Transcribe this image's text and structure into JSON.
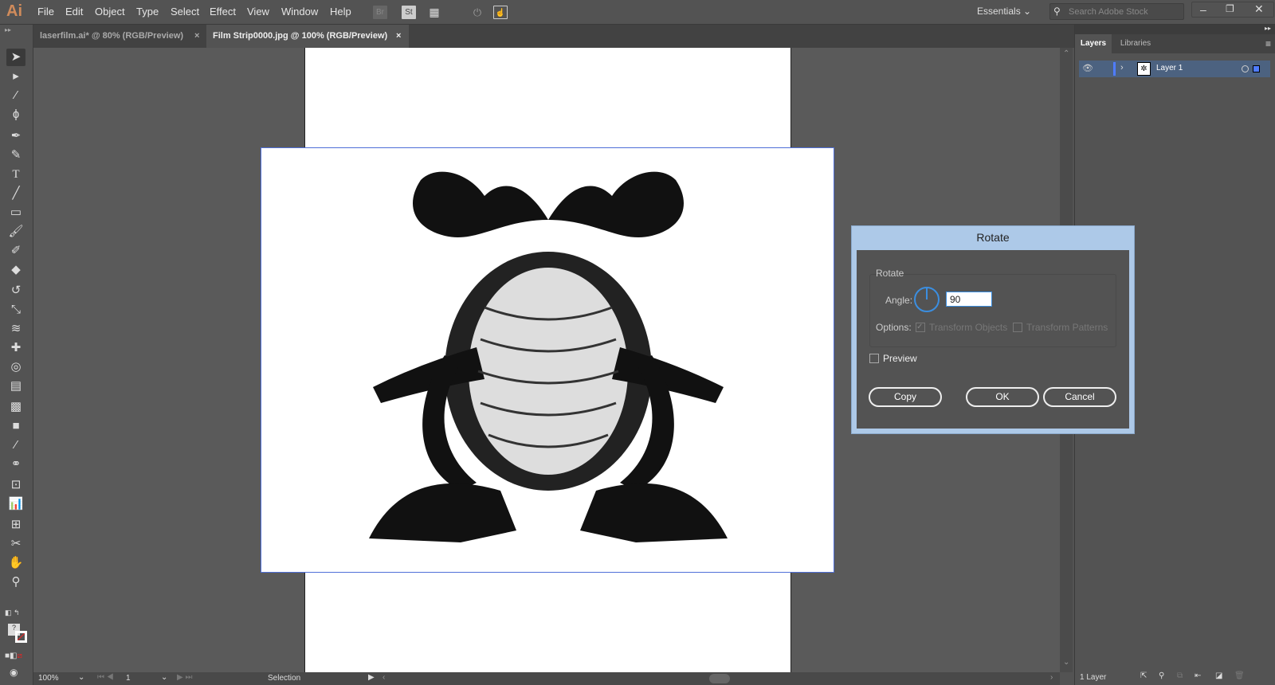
{
  "app": {
    "logo": "Ai"
  },
  "menu": [
    "File",
    "Edit",
    "Object",
    "Type",
    "Select",
    "Effect",
    "View",
    "Window",
    "Help"
  ],
  "toolbar_icons": {
    "bridge": "Br",
    "stock": "St"
  },
  "workspace": "Essentials",
  "search": {
    "placeholder": "Search Adobe Stock"
  },
  "tabs": [
    {
      "label": "laserfilm.ai* @ 80% (RGB/Preview)",
      "active": false
    },
    {
      "label": "Film Strip0000.jpg @ 100% (RGB/Preview)",
      "active": true
    }
  ],
  "panel": {
    "tabs": [
      "Layers",
      "Libraries"
    ],
    "layers": [
      {
        "name": "Layer 1",
        "color": "#4f7cff"
      }
    ],
    "footer": "1 Layer"
  },
  "status": {
    "zoom": "100%",
    "page": "1",
    "tool": "Selection"
  },
  "dialog": {
    "title": "Rotate",
    "group": "Rotate",
    "angle_label": "Angle:",
    "angle_value": "90",
    "options_label": "Options:",
    "transform_objects": "Transform Objects",
    "transform_objects_checked": true,
    "transform_patterns": "Transform Patterns",
    "transform_patterns_checked": false,
    "preview": "Preview",
    "preview_checked": false,
    "copy": "Copy",
    "ok": "OK",
    "cancel": "Cancel"
  },
  "colors": {
    "accent": "#3b8ee0",
    "dialog_title_bg": "#adc9e8",
    "selection": "#4f6fd8"
  }
}
